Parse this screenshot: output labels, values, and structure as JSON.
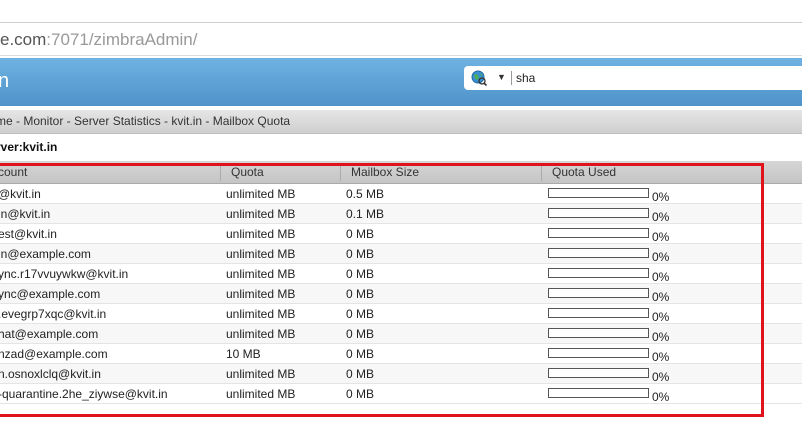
{
  "browser": {
    "url_host_part": "e.com",
    "url_rest": ":7071/zimbraAdmin/"
  },
  "header": {
    "title": "n",
    "search": {
      "engine_icon": "globe-search-icon",
      "value": "sha"
    }
  },
  "breadcrumb": "me - Monitor - Server Statistics - kvit.in - Mailbox Quota",
  "server_title": "rver:kvit.in",
  "table": {
    "columns": [
      "count",
      "Quota",
      "Mailbox Size",
      "Quota Used"
    ],
    "rows": [
      {
        "account": "@kvit.in",
        "quota": "unlimited MB",
        "size": "0.5 MB",
        "used": "0%",
        "used_fraction": 0
      },
      {
        "account": "in@kvit.in",
        "quota": "unlimited MB",
        "size": "0.1 MB",
        "used": "0%",
        "used_fraction": 0
      },
      {
        "account": "est@kvit.in",
        "quota": "unlimited MB",
        "size": "0 MB",
        "used": "0%",
        "used_fraction": 0
      },
      {
        "account": "in@example.com",
        "quota": "unlimited MB",
        "size": "0 MB",
        "used": "0%",
        "used_fraction": 0
      },
      {
        "account": "ync.r17vvuywkw@kvit.in",
        "quota": "unlimited MB",
        "size": "0 MB",
        "used": "0%",
        "used_fraction": 0
      },
      {
        "account": "ync@example.com",
        "quota": "unlimited MB",
        "size": "0 MB",
        "used": "0%",
        "used_fraction": 0
      },
      {
        "account": ".evegrp7xqc@kvit.in",
        "quota": "unlimited MB",
        "size": "0 MB",
        "used": "0%",
        "used_fraction": 0
      },
      {
        "account": "hat@example.com",
        "quota": "unlimited MB",
        "size": "0 MB",
        "used": "0%",
        "used_fraction": 0
      },
      {
        "account": "nzad@example.com",
        "quota": "10 MB",
        "size": "0 MB",
        "used": "0%",
        "used_fraction": 0
      },
      {
        "account": "n.osnoxlclq@kvit.in",
        "quota": "unlimited MB",
        "size": "0 MB",
        "used": "0%",
        "used_fraction": 0
      },
      {
        "account": "-quarantine.2he_ziywse@kvit.in",
        "quota": "unlimited MB",
        "size": "0 MB",
        "used": "0%",
        "used_fraction": 0
      }
    ]
  },
  "colors": {
    "header": "#5ea3d6",
    "highlight": "#e0121c"
  }
}
